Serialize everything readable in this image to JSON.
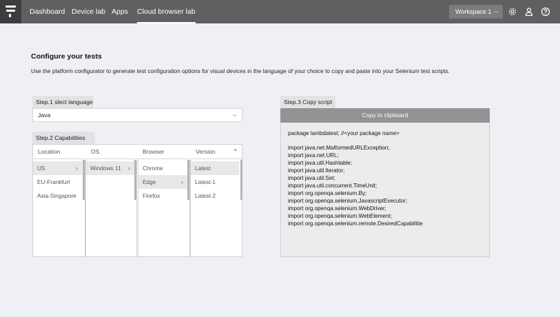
{
  "topbar": {
    "nav": [
      "Dashboard",
      "Device lab",
      "Apps",
      "Cloud browser lab"
    ],
    "active": "Cloud browser lab",
    "workspace": "Workspace 1",
    "icons": [
      "gear-icon",
      "user-icon",
      "help-icon"
    ]
  },
  "main": {
    "title": "Configure your tests",
    "description": "Use the platform configurator to generate test configuration options for visual devices in the language of your choice to copy and paste into your Selenium test scripts."
  },
  "step1": {
    "label": "Step.1 slect language",
    "selected": "Java"
  },
  "step2": {
    "label": "Step.2 Capabilities",
    "columns": [
      "Location",
      "OS",
      "Browser",
      "Version"
    ],
    "locations": [
      "US",
      "EU-Frankfurt",
      "Asia-Singapore"
    ],
    "os": [
      "Windows 11"
    ],
    "browsers": [
      "Chrome",
      "Edge",
      "Firefox"
    ],
    "versions": [
      "Latest",
      "Latest-1",
      "Latest-2"
    ]
  },
  "step3": {
    "label": "Step.3 Copy script",
    "button": "Copy to clipboard",
    "script": [
      "package lambdatest; //<your package name>",
      "import java.net.MalformedURLException;",
      "import java.net.URL;",
      "import java.util.Hashtable;",
      "import java.util.Iterator;",
      "import java.util.Set;",
      "import java.util.concurrent.TimeUnit;",
      "import org.openqa.selenium.By;",
      "import org.openqa.selenium.JavascriptExecutor;",
      "import org.openqa.selenium.WebDriver;",
      "import org.openqa.selenium.WebElement;",
      "import org.openqa.selenium.remote.DesiredCapabilitie"
    ]
  }
}
